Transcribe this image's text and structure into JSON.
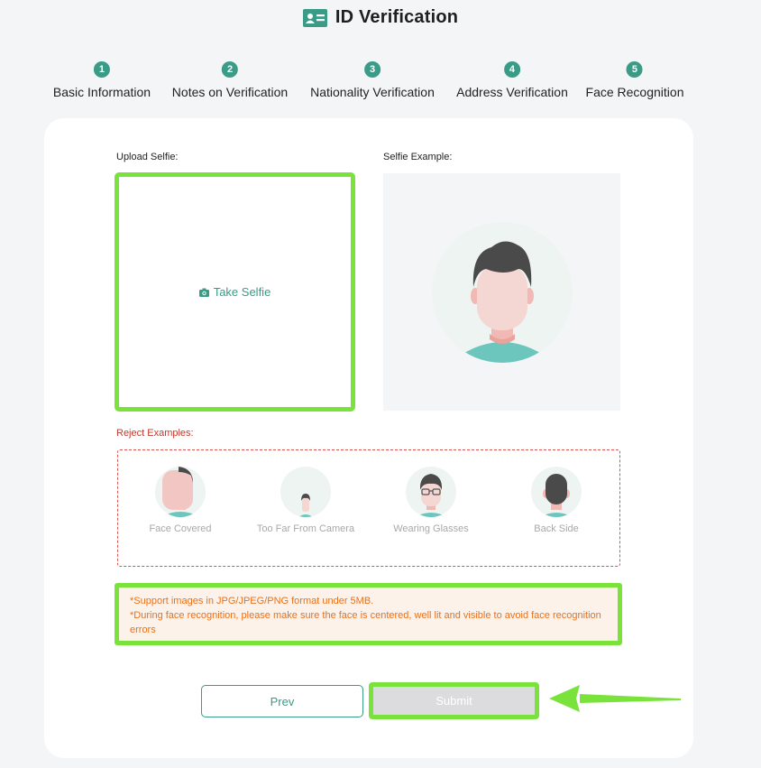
{
  "page": {
    "title": "ID Verification",
    "icon": "id-card-icon"
  },
  "steps": [
    {
      "num": "1",
      "label": "Basic Information"
    },
    {
      "num": "2",
      "label": "Notes on Verification"
    },
    {
      "num": "3",
      "label": "Nationality Verification"
    },
    {
      "num": "4",
      "label": "Address Verification"
    },
    {
      "num": "5",
      "label": "Face Recognition"
    }
  ],
  "upload": {
    "label": "Upload Selfie:",
    "button": "Take Selfie",
    "icon": "camera-icon"
  },
  "example": {
    "label": "Selfie Example:"
  },
  "reject": {
    "label": "Reject Examples:",
    "items": [
      {
        "caption": "Face Covered"
      },
      {
        "caption": "Too Far From Camera"
      },
      {
        "caption": "Wearing Glasses"
      },
      {
        "caption": "Back Side"
      }
    ]
  },
  "notice": {
    "line1": "*Support images in JPG/JPEG/PNG format under 5MB.",
    "line2": "*During face recognition, please make sure the face is centered, well lit and visible to avoid face recognition errors"
  },
  "buttons": {
    "prev": "Prev",
    "submit": "Submit"
  },
  "colors": {
    "accent": "#3a9b86",
    "highlight": "#7ae33b",
    "warning": "#e8711c",
    "reject": "#d9534f"
  }
}
